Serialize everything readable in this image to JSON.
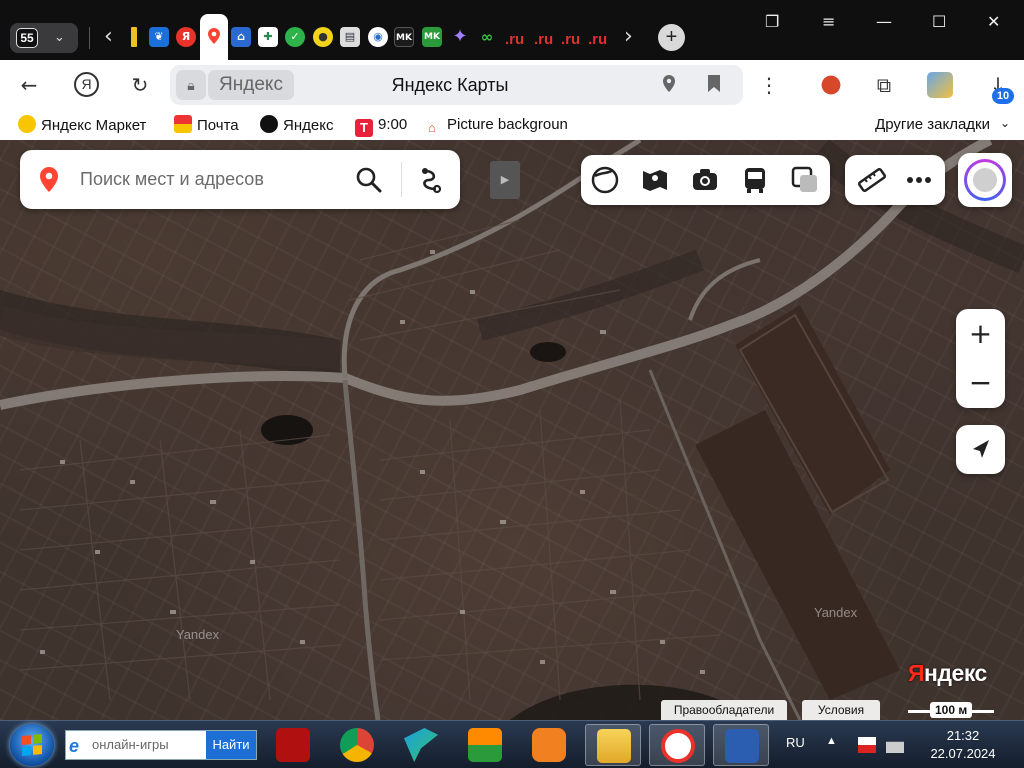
{
  "browser": {
    "tab_count": "55",
    "ru_tabs": [
      ".ru",
      ".ru",
      ".ru",
      ".ru"
    ],
    "ru_tab_fragment": ".rι",
    "omnibox": {
      "site_label": "Яндекс",
      "page_title": "Яндекс Карты"
    },
    "downloads_badge": "10",
    "bookmarks": [
      {
        "label": "Яндекс Маркет",
        "icon": "yandex-market-icon"
      },
      {
        "label": "Почта",
        "icon": "mail-icon"
      },
      {
        "label": "Яндекс",
        "icon": "yandex-icon"
      },
      {
        "label": "9:00",
        "icon": "t-icon"
      },
      {
        "label": "Picture backgroun",
        "icon": "home-icon"
      }
    ],
    "other_bookmarks": "Другие закладки"
  },
  "map": {
    "search_placeholder": "Поиск мест и адресов",
    "zoom_in": "+",
    "zoom_out": "−",
    "logo_first": "Я",
    "logo_rest": "ндекс",
    "watermarks": [
      "Yandex",
      "Yandex"
    ],
    "copyright_holders": "Правообладатели",
    "terms": "Условия",
    "scale_label": "100 м"
  },
  "taskbar": {
    "search_placeholder": "онлайн-игры",
    "search_button": "Найти",
    "language": "RU",
    "time": "21:32",
    "date": "22.07.2024"
  },
  "colors": {
    "map_base": "#3f332e",
    "road": "#8b8580",
    "accent_red": "#ff2a1a",
    "taskbar": "#1c2738"
  }
}
